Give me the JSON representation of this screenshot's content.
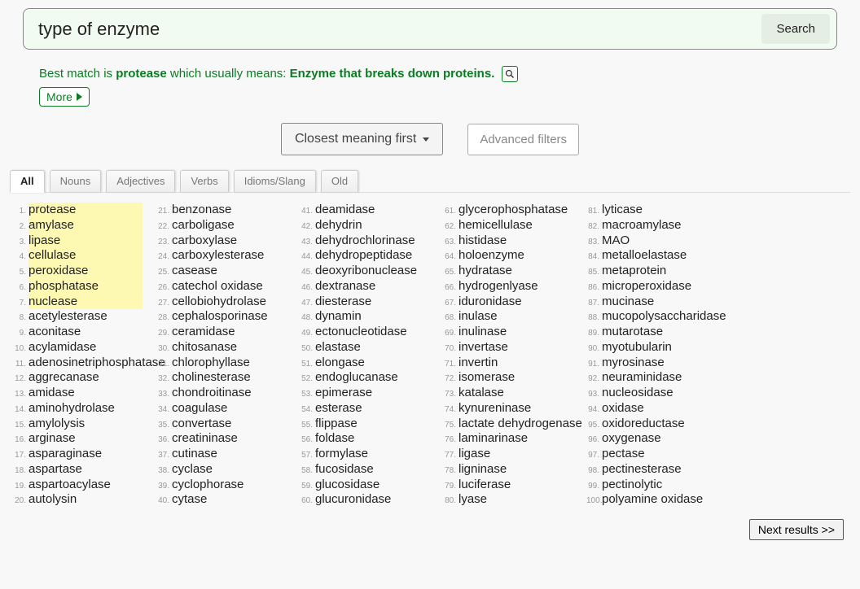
{
  "search": {
    "value": "type of enzyme",
    "button": "Search"
  },
  "match": {
    "prefix": "Best match is ",
    "word": "protease",
    "mid": " which usually means: ",
    "definition": "Enzyme that breaks down proteins.",
    "more": "More"
  },
  "controls": {
    "sort": "Closest meaning first",
    "advanced": "Advanced filters"
  },
  "tabs": [
    "All",
    "Nouns",
    "Adjectives",
    "Verbs",
    "Idioms/Slang",
    "Old"
  ],
  "activeTab": 0,
  "nextButton": "Next results >>",
  "results": [
    {
      "n": 1,
      "w": "protease",
      "hl": true
    },
    {
      "n": 2,
      "w": "amylase",
      "hl": true
    },
    {
      "n": 3,
      "w": "lipase",
      "hl": true
    },
    {
      "n": 4,
      "w": "cellulase",
      "hl": true
    },
    {
      "n": 5,
      "w": "peroxidase",
      "hl": true
    },
    {
      "n": 6,
      "w": "phosphatase",
      "hl": true
    },
    {
      "n": 7,
      "w": "nuclease",
      "hl": true
    },
    {
      "n": 8,
      "w": "acetylesterase"
    },
    {
      "n": 9,
      "w": "aconitase"
    },
    {
      "n": 10,
      "w": "acylamidase"
    },
    {
      "n": 11,
      "w": "adenosinetriphosphatase"
    },
    {
      "n": 12,
      "w": "aggrecanase"
    },
    {
      "n": 13,
      "w": "amidase"
    },
    {
      "n": 14,
      "w": "aminohydrolase"
    },
    {
      "n": 15,
      "w": "amylolysis"
    },
    {
      "n": 16,
      "w": "arginase"
    },
    {
      "n": 17,
      "w": "asparaginase"
    },
    {
      "n": 18,
      "w": "aspartase"
    },
    {
      "n": 19,
      "w": "aspartoacylase"
    },
    {
      "n": 20,
      "w": "autolysin"
    },
    {
      "n": 21,
      "w": "benzonase"
    },
    {
      "n": 22,
      "w": "carboligase"
    },
    {
      "n": 23,
      "w": "carboxylase"
    },
    {
      "n": 24,
      "w": "carboxylesterase"
    },
    {
      "n": 25,
      "w": "casease"
    },
    {
      "n": 26,
      "w": "catechol oxidase"
    },
    {
      "n": 27,
      "w": "cellobiohydrolase"
    },
    {
      "n": 28,
      "w": "cephalosporinase"
    },
    {
      "n": 29,
      "w": "ceramidase"
    },
    {
      "n": 30,
      "w": "chitosanase"
    },
    {
      "n": 31,
      "w": "chlorophyllase"
    },
    {
      "n": 32,
      "w": "cholinesterase"
    },
    {
      "n": 33,
      "w": "chondroitinase"
    },
    {
      "n": 34,
      "w": "coagulase"
    },
    {
      "n": 35,
      "w": "convertase"
    },
    {
      "n": 36,
      "w": "creatininase"
    },
    {
      "n": 37,
      "w": "cutinase"
    },
    {
      "n": 38,
      "w": "cyclase"
    },
    {
      "n": 39,
      "w": "cyclophorase"
    },
    {
      "n": 40,
      "w": "cytase"
    },
    {
      "n": 41,
      "w": "deamidase"
    },
    {
      "n": 42,
      "w": "dehydrin"
    },
    {
      "n": 43,
      "w": "dehydrochlorinase"
    },
    {
      "n": 44,
      "w": "dehydropeptidase"
    },
    {
      "n": 45,
      "w": "deoxyribonuclease"
    },
    {
      "n": 46,
      "w": "dextranase"
    },
    {
      "n": 47,
      "w": "diesterase"
    },
    {
      "n": 48,
      "w": "dynamin"
    },
    {
      "n": 49,
      "w": "ectonucleotidase"
    },
    {
      "n": 50,
      "w": "elastase"
    },
    {
      "n": 51,
      "w": "elongase"
    },
    {
      "n": 52,
      "w": "endoglucanase"
    },
    {
      "n": 53,
      "w": "epimerase"
    },
    {
      "n": 54,
      "w": "esterase"
    },
    {
      "n": 55,
      "w": "flippase"
    },
    {
      "n": 56,
      "w": "foldase"
    },
    {
      "n": 57,
      "w": "formylase"
    },
    {
      "n": 58,
      "w": "fucosidase"
    },
    {
      "n": 59,
      "w": "glucosidase"
    },
    {
      "n": 60,
      "w": "glucuronidase"
    },
    {
      "n": 61,
      "w": "glycerophosphatase"
    },
    {
      "n": 62,
      "w": "hemicellulase"
    },
    {
      "n": 63,
      "w": "histidase"
    },
    {
      "n": 64,
      "w": "holoenzyme"
    },
    {
      "n": 65,
      "w": "hydratase"
    },
    {
      "n": 66,
      "w": "hydrogenlyase"
    },
    {
      "n": 67,
      "w": "iduronidase"
    },
    {
      "n": 68,
      "w": "inulase"
    },
    {
      "n": 69,
      "w": "inulinase"
    },
    {
      "n": 70,
      "w": "invertase"
    },
    {
      "n": 71,
      "w": "invertin"
    },
    {
      "n": 72,
      "w": "isomerase"
    },
    {
      "n": 73,
      "w": "katalase"
    },
    {
      "n": 74,
      "w": "kynureninase"
    },
    {
      "n": 75,
      "w": "lactate dehydrogenase"
    },
    {
      "n": 76,
      "w": "laminarinase"
    },
    {
      "n": 77,
      "w": "ligase"
    },
    {
      "n": 78,
      "w": "ligninase"
    },
    {
      "n": 79,
      "w": "luciferase"
    },
    {
      "n": 80,
      "w": "lyase"
    },
    {
      "n": 81,
      "w": "lyticase"
    },
    {
      "n": 82,
      "w": "macroamylase"
    },
    {
      "n": 83,
      "w": "MAO"
    },
    {
      "n": 84,
      "w": "metalloelastase"
    },
    {
      "n": 85,
      "w": "metaprotein"
    },
    {
      "n": 86,
      "w": "microperoxidase"
    },
    {
      "n": 87,
      "w": "mucinase"
    },
    {
      "n": 88,
      "w": "mucopolysaccharidase"
    },
    {
      "n": 89,
      "w": "mutarotase"
    },
    {
      "n": 90,
      "w": "myotubularin"
    },
    {
      "n": 91,
      "w": "myrosinase"
    },
    {
      "n": 92,
      "w": "neuraminidase"
    },
    {
      "n": 93,
      "w": "nucleosidase"
    },
    {
      "n": 94,
      "w": "oxidase"
    },
    {
      "n": 95,
      "w": "oxidoreductase"
    },
    {
      "n": 96,
      "w": "oxygenase"
    },
    {
      "n": 97,
      "w": "pectase"
    },
    {
      "n": 98,
      "w": "pectinesterase"
    },
    {
      "n": 99,
      "w": "pectinolytic"
    },
    {
      "n": 100,
      "w": "polyamine oxidase"
    }
  ],
  "columnBreaks": [
    20,
    20,
    20,
    20,
    20
  ]
}
